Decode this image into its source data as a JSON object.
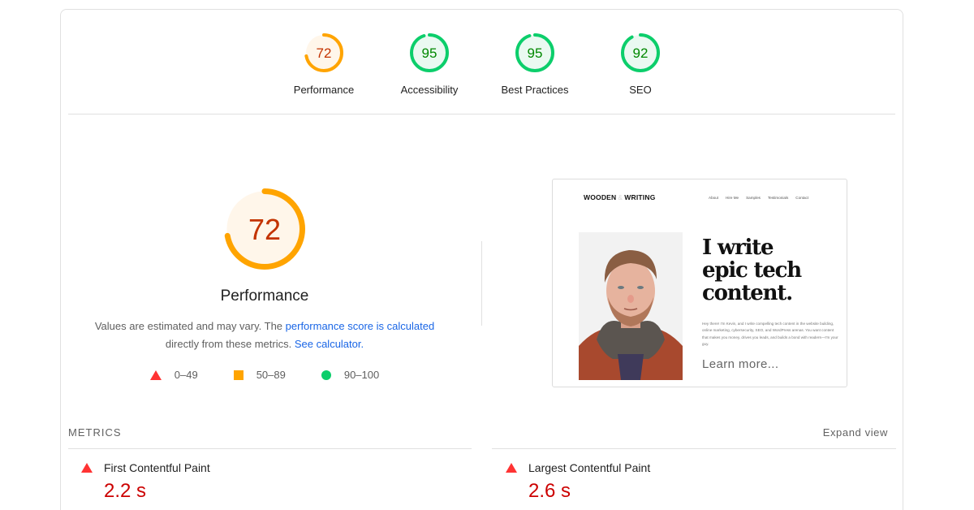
{
  "colors": {
    "fail": "#ff3333",
    "average": "#ffa400",
    "pass": "#0cce6b",
    "fail_text": "#c00",
    "average_text": "#c33300",
    "pass_text": "#080",
    "average_bg": "#fff6ea",
    "pass_bg": "#eaf9f1",
    "link": "#1a66e6"
  },
  "gauges": [
    {
      "label": "Performance",
      "score": 72,
      "rating": "average"
    },
    {
      "label": "Accessibility",
      "score": 95,
      "rating": "pass"
    },
    {
      "label": "Best Practices",
      "score": 95,
      "rating": "pass"
    },
    {
      "label": "SEO",
      "score": 92,
      "rating": "pass"
    }
  ],
  "performance": {
    "score": 72,
    "rating": "average",
    "title": "Performance",
    "desc_prefix": "Values are estimated and may vary. The ",
    "desc_link1": "performance score is calculated",
    "desc_middle": " directly from these metrics. ",
    "desc_link2": "See calculator."
  },
  "legend": [
    {
      "shape": "triangle",
      "label": "0–49"
    },
    {
      "shape": "square",
      "label": "50–89"
    },
    {
      "shape": "circle",
      "label": "90–100"
    }
  ],
  "screenshot": {
    "logo_left": "WOODEN",
    "logo_sep": "&",
    "logo_right": "WRITING",
    "nav": [
      "About",
      "Hire Me",
      "Samples",
      "Testimonials",
      "Contact"
    ],
    "headline_1": "I write",
    "headline_2": "epic tech",
    "headline_3": "content.",
    "body": "Hey there! I'm Kevin, and I write compelling tech content in the website building, online marketing, cybersecurity, SEO, and WordPress arenas. You want content that makes you money, drives you leads, and builds a bond with readers—I'm your guy.",
    "cta": "Learn more..."
  },
  "metrics": {
    "heading": "METRICS",
    "expand_label": "Expand view",
    "items": [
      {
        "name": "First Contentful Paint",
        "value": "2.2 s",
        "rating": "fail"
      },
      {
        "name": "Largest Contentful Paint",
        "value": "2.6 s",
        "rating": "fail"
      }
    ]
  }
}
